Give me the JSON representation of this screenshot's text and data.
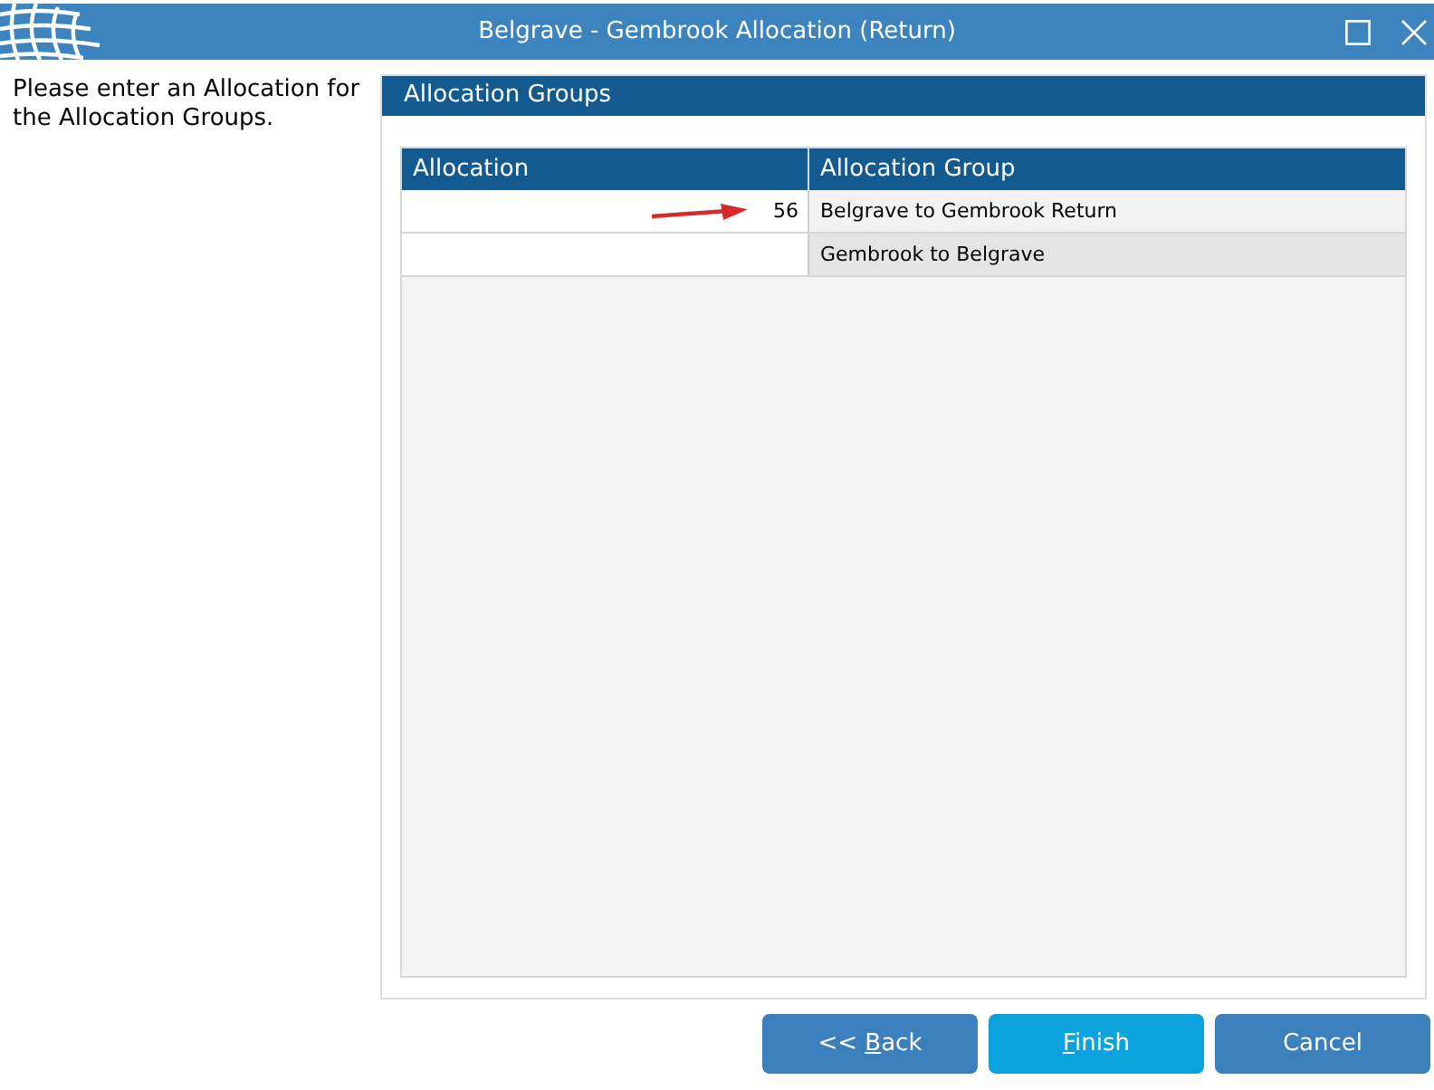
{
  "window": {
    "title": "Belgrave - Gembrook Allocation (Return)"
  },
  "instructions": "Please enter an Allocation for the Allocation Groups.",
  "panel": {
    "title": "Allocation Groups",
    "table": {
      "columns": [
        "Allocation",
        "Allocation Group"
      ],
      "rows": [
        {
          "allocation": "56",
          "allocation_group": "Belgrave to Gembrook Return",
          "pointer_arrow": true
        },
        {
          "allocation_group": "Gembrook to Belgrave",
          "pointer_arrow": false
        }
      ]
    }
  },
  "buttons": [
    {
      "label_before": "<< ",
      "access_key": "B",
      "label_after": "ack",
      "default": false
    },
    {
      "access_key": "F",
      "label_after": "inish",
      "default": true
    },
    {
      "label_before": "Cancel",
      "default": false
    }
  ]
}
